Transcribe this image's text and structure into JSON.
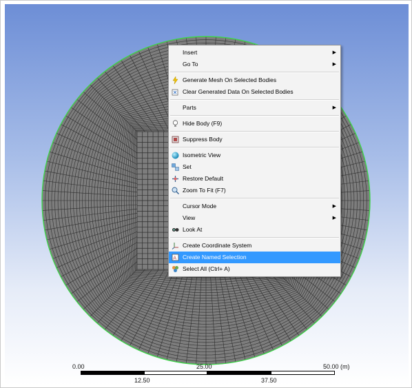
{
  "menu": {
    "groups": [
      [
        {
          "label": "Insert",
          "submenu": true,
          "icon": ""
        },
        {
          "label": "Go To",
          "submenu": true,
          "icon": ""
        }
      ],
      [
        {
          "label": "Generate Mesh On Selected Bodies",
          "submenu": false,
          "icon": "lightning-icon"
        },
        {
          "label": "Clear Generated Data On Selected Bodies",
          "submenu": false,
          "icon": "clear-data-icon"
        }
      ],
      [
        {
          "label": "Parts",
          "submenu": true,
          "icon": ""
        }
      ],
      [
        {
          "label": "Hide Body (F9)",
          "submenu": false,
          "icon": "lightbulb-icon"
        }
      ],
      [
        {
          "label": "Suppress Body",
          "submenu": false,
          "icon": "suppress-icon"
        }
      ],
      [
        {
          "label": "Isometric View",
          "submenu": false,
          "icon": "isometric-sphere-icon"
        },
        {
          "label": "Set",
          "submenu": false,
          "icon": "set-view-icon"
        },
        {
          "label": "Restore Default",
          "submenu": false,
          "icon": "restore-default-icon"
        },
        {
          "label": "Zoom To Fit (F7)",
          "submenu": false,
          "icon": "zoom-fit-icon"
        }
      ],
      [
        {
          "label": "Cursor Mode",
          "submenu": true,
          "icon": ""
        },
        {
          "label": "View",
          "submenu": true,
          "icon": ""
        },
        {
          "label": "Look At",
          "submenu": false,
          "icon": "look-at-icon"
        }
      ],
      [
        {
          "label": "Create Coordinate System",
          "submenu": false,
          "icon": "coordinate-system-icon"
        },
        {
          "label": "Create Named Selection",
          "submenu": false,
          "icon": "named-selection-icon",
          "highlighted": true
        },
        {
          "label": "Select All (Ctrl+ A)",
          "submenu": false,
          "icon": "select-all-icon"
        }
      ]
    ]
  },
  "scale": {
    "top_labels": [
      "0.00",
      "25.00",
      "50.00 (m)"
    ],
    "bottom_labels": [
      "12.50",
      "37.50"
    ]
  },
  "colors": {
    "mesh_fill": "#7d7d7d",
    "mesh_line": "#2e2e2e",
    "mesh_edge": "#3fd24a",
    "highlight": "#3399ff"
  }
}
